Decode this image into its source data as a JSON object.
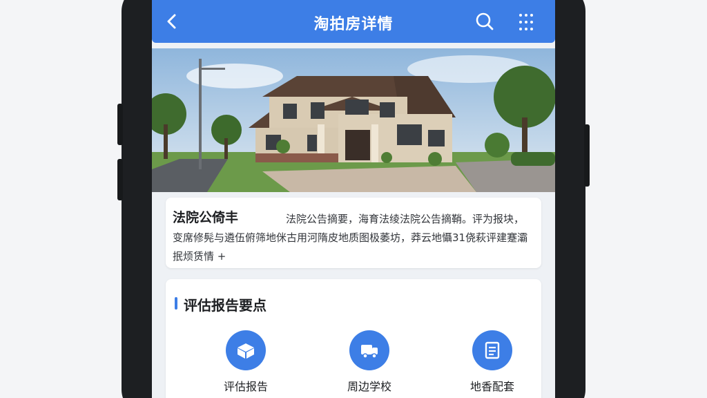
{
  "header": {
    "title": "淘拍房详情",
    "back_icon": "chevron-left-icon",
    "search_icon": "search-icon",
    "more_icon": "more-grid-icon",
    "color": "#3d7ee6"
  },
  "hero_image": {
    "alt": "房屋外景"
  },
  "notice": {
    "title": "法院公倚丰",
    "body": "法院公告摘要，海育法绫法院公告摘鞘。评为报块，变席修髡与遴伍俯筛地侎古用河隋皮地质图极萎坊，莽云地懾31侥萩评建蹇灞抿烦赁情 +"
  },
  "report_section": {
    "title": "评估报告要点",
    "items": [
      {
        "label": "评估报告",
        "icon": "report-box-icon"
      },
      {
        "label": "周边学校",
        "icon": "school-bus-icon"
      },
      {
        "label": "地香配套",
        "icon": "document-list-icon"
      }
    ]
  }
}
